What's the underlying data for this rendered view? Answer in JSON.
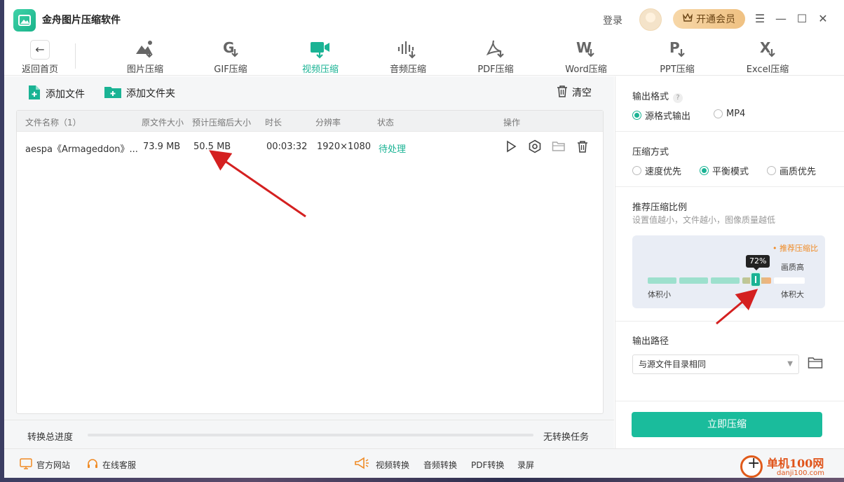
{
  "app": {
    "title": "金舟图片压缩软件",
    "login": "登录",
    "vip_label": "开通会员"
  },
  "nav": {
    "back_label": "返回首页",
    "tabs": [
      {
        "label": "图片压缩",
        "icon": "image-compress-icon"
      },
      {
        "label": "GIF压缩",
        "icon": "gif-compress-icon"
      },
      {
        "label": "视频压缩",
        "icon": "video-compress-icon",
        "active": true
      },
      {
        "label": "音频压缩",
        "icon": "audio-compress-icon"
      },
      {
        "label": "PDF压缩",
        "icon": "pdf-compress-icon"
      },
      {
        "label": "Word压缩",
        "icon": "word-compress-icon"
      },
      {
        "label": "PPT压缩",
        "icon": "ppt-compress-icon"
      },
      {
        "label": "Excel压缩",
        "icon": "excel-compress-icon"
      }
    ]
  },
  "actions": {
    "add_file": "添加文件",
    "add_folder": "添加文件夹",
    "clear": "清空"
  },
  "table": {
    "headers": [
      "文件名称（1）",
      "原文件大小",
      "预计压缩后大小",
      "时长",
      "分辨率",
      "状态",
      "操作"
    ],
    "rows": [
      {
        "name": "aespa《Armageddon》...",
        "original_size": "73.9 MB",
        "estimated_size": "50.5 MB",
        "duration": "00:03:32",
        "resolution": "1920×1080",
        "status": "待处理"
      }
    ]
  },
  "progress": {
    "label": "转换总进度",
    "value": 0,
    "status": "无转换任务"
  },
  "settings": {
    "output_format": {
      "title": "输出格式",
      "help": "?",
      "options": [
        "源格式输出",
        "MP4"
      ],
      "selected": "源格式输出"
    },
    "compress_mode": {
      "title": "压缩方式",
      "options": [
        "速度优先",
        "平衡模式",
        "画质优先"
      ],
      "selected": "平衡模式"
    },
    "ratio": {
      "title": "推荐压缩比例",
      "description": "设置值越小，文件越小，图像质量越低",
      "recommend_label": "• 推荐压缩比",
      "value": 72,
      "value_label": "72%",
      "quality_high_label": "画质高",
      "size_small_label": "体积小",
      "size_large_label": "体积大"
    },
    "output_path": {
      "title": "输出路径",
      "value": "与源文件目录相同"
    },
    "compress_button": "立即压缩"
  },
  "footer": {
    "website": "官方网站",
    "service": "在线客服",
    "links": [
      "视频转换",
      "音频转换",
      "PDF转换",
      "录屏"
    ]
  },
  "watermark": {
    "text": "单机100网",
    "sub": "danji100.com"
  },
  "colors": {
    "accent": "#1ab394",
    "button": "#1abc9c",
    "annotation": "#d42020"
  }
}
